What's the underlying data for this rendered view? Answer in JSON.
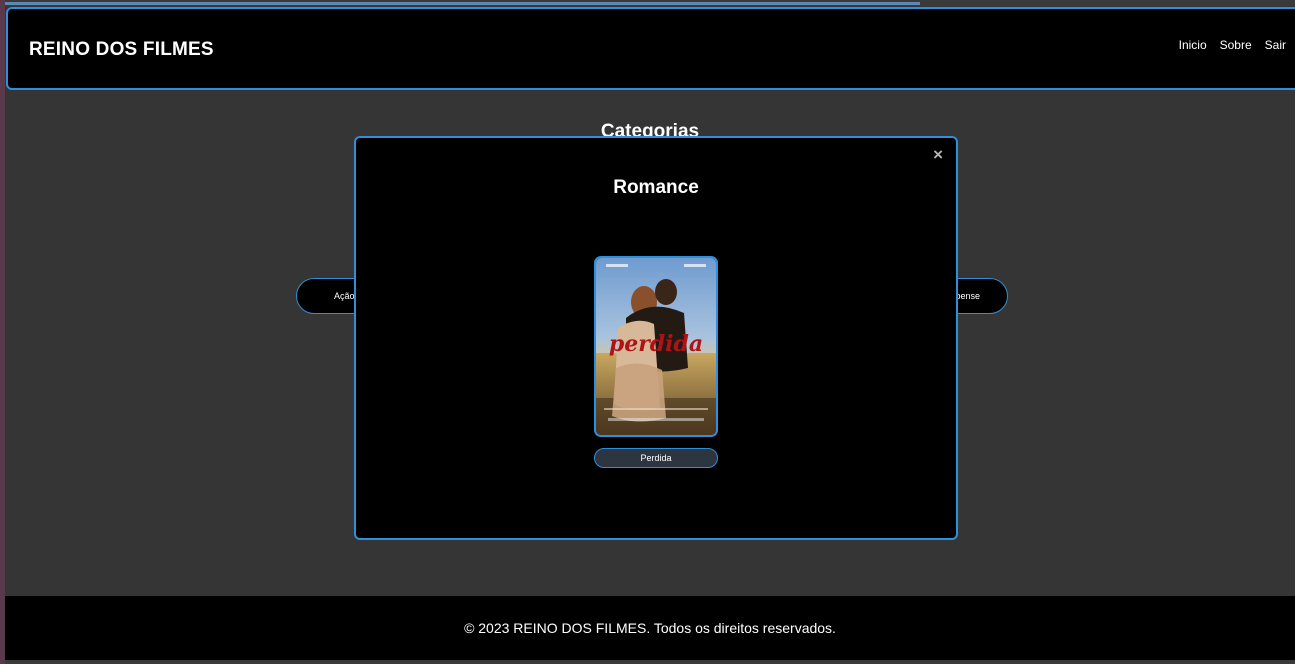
{
  "header": {
    "brand": "REINO DOS FILMES",
    "nav": [
      "Inicio",
      "Sobre",
      "Sair"
    ]
  },
  "categories_page": {
    "title": "Categorias",
    "visible_pill_left": "Ação",
    "visible_pill_right": "pense"
  },
  "modal": {
    "title": "Romance",
    "close_glyph": "×",
    "movies": [
      {
        "name": "Perdida",
        "poster_title": "perdida"
      }
    ]
  },
  "footer": {
    "text": "© 2023 REINO DOS FILMES. Todos os direitos reservados."
  },
  "colors": {
    "accent": "#2f8fd8",
    "background": "#353535",
    "surface": "#000000",
    "text": "#ffffff"
  }
}
